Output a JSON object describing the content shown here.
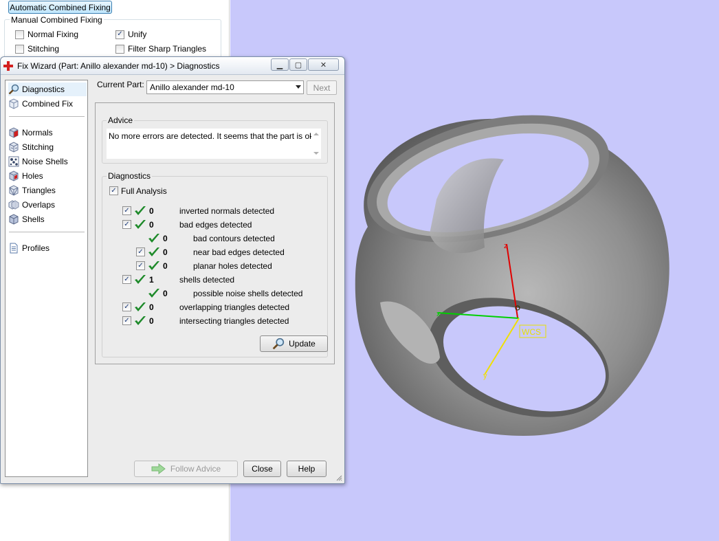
{
  "background_panel": {
    "auto_fix_button": "Automatic Combined Fixing",
    "manual_group_title": "Manual Combined Fixing",
    "options": [
      {
        "label": "Normal Fixing",
        "checked": false
      },
      {
        "label": "Unify",
        "checked": true
      },
      {
        "label": "Stitching",
        "checked": false
      },
      {
        "label": "Filter Sharp Triangles",
        "checked": false
      }
    ]
  },
  "dialog": {
    "title": "Fix Wizard (Part: Anillo alexander md-10) > Diagnostics",
    "window_buttons": {
      "minimize": "▭",
      "maximize": "▢",
      "close": "✕"
    },
    "nav": {
      "group1": [
        {
          "label": "Diagnostics",
          "icon": "magnifier-icon",
          "selected": true
        },
        {
          "label": "Combined Fix",
          "icon": "cube-icon",
          "selected": false
        }
      ],
      "group2": [
        {
          "label": "Normals",
          "icon": "normals-cube-icon"
        },
        {
          "label": "Stitching",
          "icon": "stitching-cube-icon"
        },
        {
          "label": "Noise Shells",
          "icon": "noise-shells-icon"
        },
        {
          "label": "Holes",
          "icon": "holes-cube-icon"
        },
        {
          "label": "Triangles",
          "icon": "triangles-cube-icon"
        },
        {
          "label": "Overlaps",
          "icon": "overlaps-icon"
        },
        {
          "label": "Shells",
          "icon": "shells-icon"
        }
      ],
      "group3": [
        {
          "label": "Profiles",
          "icon": "document-icon"
        }
      ]
    },
    "current_part_label": "Current Part:",
    "current_part_value": "Anillo alexander md-10",
    "next_button": "Next",
    "advice": {
      "title": "Advice",
      "text": "No more errors are detected. It seems that the part is ok."
    },
    "diagnostics": {
      "title": "Diagnostics",
      "full_analysis_label": "Full Analysis",
      "full_analysis_checked": true,
      "rows": [
        {
          "count": "0",
          "label": "inverted normals detected",
          "indent": 0,
          "checkbox": true
        },
        {
          "count": "0",
          "label": "bad edges detected",
          "indent": 0,
          "checkbox": true
        },
        {
          "count": "0",
          "label": "bad contours detected",
          "indent": 1,
          "checkbox": false
        },
        {
          "count": "0",
          "label": "near bad edges detected",
          "indent": 1,
          "checkbox": true
        },
        {
          "count": "0",
          "label": "planar holes detected",
          "indent": 1,
          "checkbox": true
        },
        {
          "count": "1",
          "label": "shells detected",
          "indent": 0,
          "checkbox": true
        },
        {
          "count": "0",
          "label": "possible noise shells detected",
          "indent": 1,
          "checkbox": false
        },
        {
          "count": "0",
          "label": "overlapping triangles detected",
          "indent": 0,
          "checkbox": true
        },
        {
          "count": "0",
          "label": "intersecting triangles detected",
          "indent": 0,
          "checkbox": true
        }
      ],
      "update_button": "Update"
    },
    "buttons": {
      "follow_advice": "Follow Advice",
      "close": "Close",
      "help": "Help"
    }
  },
  "viewport": {
    "background_color": "#c8c8fb",
    "axis_labels": {
      "z": "z",
      "x": "x",
      "y": "y"
    },
    "wcs_label": "WCS"
  }
}
